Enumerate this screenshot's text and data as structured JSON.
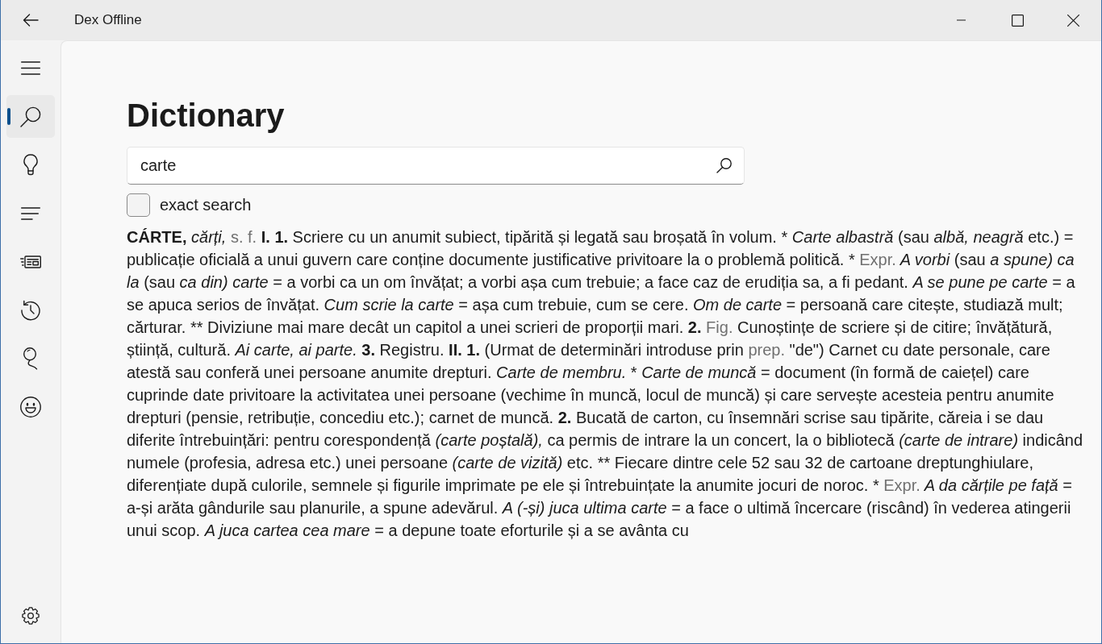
{
  "window": {
    "title": "Dex Offline"
  },
  "nav": {
    "items": [
      {
        "selected": true
      },
      {
        "selected": false
      },
      {
        "selected": false
      },
      {
        "selected": false
      },
      {
        "selected": false
      },
      {
        "selected": false
      },
      {
        "selected": false
      }
    ]
  },
  "page": {
    "title": "Dictionary",
    "search": {
      "value": "carte"
    },
    "exact_search": {
      "label": "exact search",
      "checked": false
    },
    "definition": [
      {
        "kind": "bold",
        "text": "CÁRTE,"
      },
      {
        "kind": "italic",
        "text": " cărți,"
      },
      {
        "kind": "abbr",
        "text": " s. f."
      },
      {
        "kind": "bold",
        "text": " I. 1."
      },
      {
        "kind": "plain",
        "text": " Scriere cu un anumit subiect, tipărită și legată sau broșată în volum. * "
      },
      {
        "kind": "italic",
        "text": "Carte albastră"
      },
      {
        "kind": "plain",
        "text": " (sau "
      },
      {
        "kind": "italic",
        "text": "albă, neagră"
      },
      {
        "kind": "plain",
        "text": " etc.) = publicație oficială a unui guvern care conține documente justificative privitoare la o problemă politică. * "
      },
      {
        "kind": "abbr",
        "text": "Expr."
      },
      {
        "kind": "italic",
        "text": " A vorbi"
      },
      {
        "kind": "plain",
        "text": " (sau "
      },
      {
        "kind": "italic",
        "text": "a spune) ca la"
      },
      {
        "kind": "plain",
        "text": " (sau "
      },
      {
        "kind": "italic",
        "text": "ca din) carte"
      },
      {
        "kind": "plain",
        "text": " = a vorbi ca un om învățat; a vorbi așa cum trebuie; a face caz de erudiția sa, a fi pedant. "
      },
      {
        "kind": "italic",
        "text": "A se pune pe carte"
      },
      {
        "kind": "plain",
        "text": " = a se apuca serios de învățat. "
      },
      {
        "kind": "italic",
        "text": "Cum scrie la carte"
      },
      {
        "kind": "plain",
        "text": " = așa cum trebuie, cum se cere. "
      },
      {
        "kind": "italic",
        "text": "Om de carte"
      },
      {
        "kind": "plain",
        "text": " = persoană care citește, studiază mult; cărturar. ** Diviziune mai mare decât un capitol a unei scrieri de proporții mari. "
      },
      {
        "kind": "bold",
        "text": "2."
      },
      {
        "kind": "abbr",
        "text": " Fig."
      },
      {
        "kind": "plain",
        "text": " Cunoștințe de scriere și de citire; învățătură, știință, cultură. "
      },
      {
        "kind": "italic",
        "text": "Ai carte, ai parte."
      },
      {
        "kind": "bold",
        "text": " 3."
      },
      {
        "kind": "plain",
        "text": " Registru. "
      },
      {
        "kind": "bold",
        "text": "II. 1."
      },
      {
        "kind": "plain",
        "text": " (Urmat de determinări introduse prin "
      },
      {
        "kind": "abbr",
        "text": "prep."
      },
      {
        "kind": "plain",
        "text": " \"de\") Carnet cu date personale, care atestă sau conferă unei persoane anumite drepturi. "
      },
      {
        "kind": "italic",
        "text": "Carte de membru."
      },
      {
        "kind": "plain",
        "text": " * "
      },
      {
        "kind": "italic",
        "text": "Carte de muncă"
      },
      {
        "kind": "plain",
        "text": " = document (în formă de caiețel) care cuprinde date privitoare la activitatea unei persoane (vechime în muncă, locul de muncă) și care servește acesteia pentru anumite drepturi (pensie, retribuție, concediu etc.); carnet de muncă. "
      },
      {
        "kind": "bold",
        "text": "2."
      },
      {
        "kind": "plain",
        "text": " Bucată de carton, cu însemnări scrise sau tipărite, căreia i se dau diferite întrebuințări: pentru corespondență "
      },
      {
        "kind": "italic",
        "text": "(carte poștală),"
      },
      {
        "kind": "plain",
        "text": " ca permis de intrare la un concert, la o bibliotecă "
      },
      {
        "kind": "italic",
        "text": "(carte de intrare)"
      },
      {
        "kind": "plain",
        "text": " indicând numele (profesia, adresa etc.) unei persoane "
      },
      {
        "kind": "italic",
        "text": "(carte de vizită)"
      },
      {
        "kind": "plain",
        "text": " etc. ** Fiecare dintre cele 52 sau 32 de cartoane dreptunghiulare, diferențiate după culorile, semnele și figurile imprimate pe ele și întrebuințate la anumite jocuri de noroc. * "
      },
      {
        "kind": "abbr",
        "text": "Expr."
      },
      {
        "kind": "italic",
        "text": " A da cărțile pe față"
      },
      {
        "kind": "plain",
        "text": " = a-și arăta gândurile sau planurile, a spune adevărul. "
      },
      {
        "kind": "italic",
        "text": "A (-și) juca ultima carte"
      },
      {
        "kind": "plain",
        "text": " = a face o ultimă încercare (riscând) în vederea atingerii unui scop. "
      },
      {
        "kind": "italic",
        "text": "A juca cartea cea mare"
      },
      {
        "kind": "plain",
        "text": " = a depune toate eforturile și a se avânta cu"
      }
    ]
  }
}
